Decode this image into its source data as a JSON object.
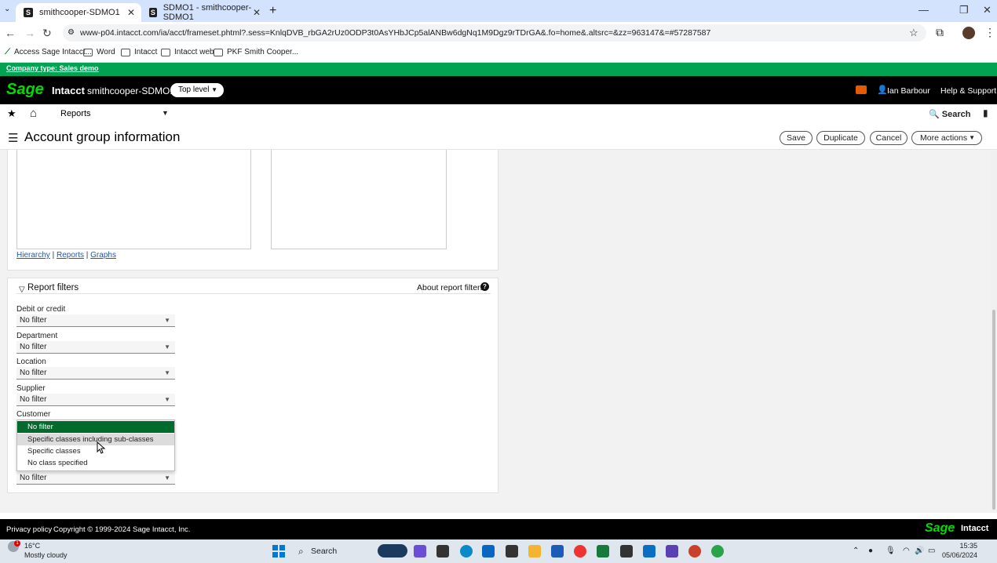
{
  "browser": {
    "tabs": [
      {
        "label": "smithcooper-SDMO1",
        "favicon": "S"
      },
      {
        "label": "SDMO1 - smithcooper-SDMO1",
        "favicon": "S"
      }
    ],
    "url": "www-p04.intacct.com/ia/acct/frameset.phtml?.sess=KnlqDVB_rbGA2rUz0ODP3t0AsYHbJCp5alANBw6dgNq1M9Dgz9rTDrGA&.fo=home&.altsrc=&zz=963147&=#57287587",
    "bookmarks": [
      "Access Sage Intacct...",
      "Word",
      "Intacct",
      "Intacct web",
      "PKF Smith Cooper..."
    ]
  },
  "app": {
    "company_type": "Company type: Sales demo",
    "logo_text": "Sage",
    "product_name": "Intacct",
    "company_name": "smithcooper-SDMO1",
    "top_level_label": "Top level",
    "user_name": "Ian Barbour",
    "help_label": "Help & Support",
    "nav_menu": "Reports",
    "search_label": "Search",
    "colors": {
      "brand_green": "#00dc00",
      "company_bar": "#00a351",
      "selected_item": "#006b2d"
    }
  },
  "page": {
    "title": "Account group information",
    "buttons": {
      "save": "Save",
      "duplicate": "Duplicate",
      "cancel": "Cancel",
      "more_actions": "More actions"
    }
  },
  "links": {
    "hierarchy": "Hierarchy",
    "sep1": "|",
    "reports": "Reports",
    "sep2": "|",
    "graphs": "Graphs"
  },
  "report_filters": {
    "title": "Report filters",
    "about_link": "About report filters",
    "fields": [
      {
        "label": "Debit or credit",
        "value": "No filter"
      },
      {
        "label": "Department",
        "value": "No filter"
      },
      {
        "label": "Location",
        "value": "No filter"
      },
      {
        "label": "Supplier",
        "value": "No filter"
      },
      {
        "label": "Customer",
        "value": ""
      },
      {
        "label": "",
        "value": "No filter"
      }
    ],
    "dropdown_options": [
      "No filter",
      "Specific classes including sub-classes",
      "Specific classes",
      "No class specified"
    ]
  },
  "footer": {
    "privacy": "Privacy policy",
    "copyright": "Copyright © 1999-2024 Sage Intacct, Inc.",
    "sage": "Sage",
    "intacct": "Intacct"
  },
  "taskbar": {
    "badge": "1",
    "temp": "16°C",
    "weather": "Mostly cloudy",
    "search": "Search",
    "time": "15:35",
    "date": "05/06/2024"
  }
}
